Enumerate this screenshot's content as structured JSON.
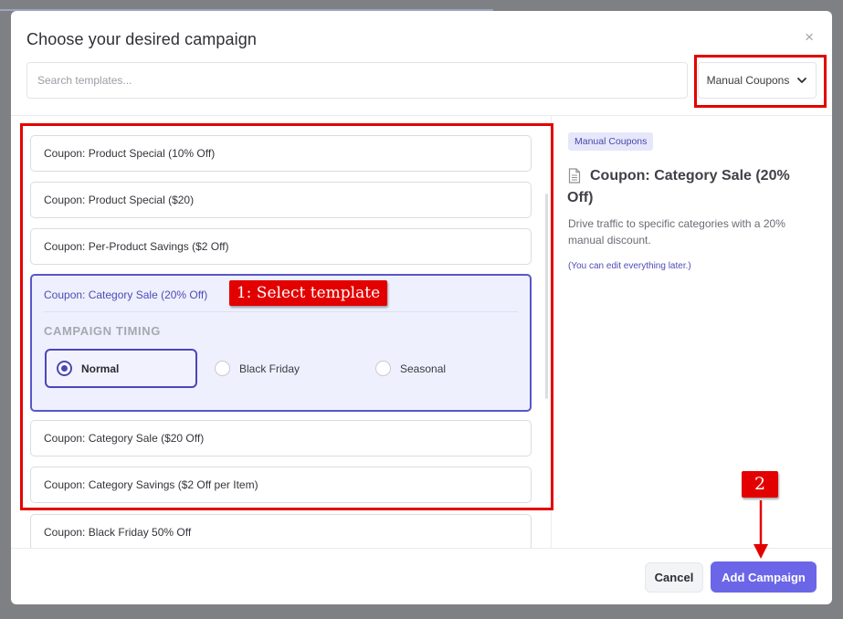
{
  "modal": {
    "title": "Choose your desired campaign",
    "close_glyph": "×"
  },
  "search": {
    "placeholder": "Search templates..."
  },
  "filter": {
    "selected": "Manual Coupons",
    "icon": "chevron-down-icon"
  },
  "templates": {
    "items": [
      {
        "label": "Coupon: Product Special (10% Off)"
      },
      {
        "label": "Coupon: Product Special ($20)"
      },
      {
        "label": "Coupon: Per-Product Savings ($2 Off)"
      },
      {
        "label": "Coupon: Category Sale (20% Off)",
        "selected": true
      },
      {
        "label": "Coupon: Category Sale ($20 Off)"
      },
      {
        "label": "Coupon: Category Savings ($2 Off per Item)"
      },
      {
        "label": "Coupon: Black Friday 50% Off"
      }
    ],
    "timing": {
      "label": "CAMPAIGN TIMING",
      "options": [
        {
          "label": "Normal",
          "selected": true
        },
        {
          "label": "Black Friday",
          "selected": false
        },
        {
          "label": "Seasonal",
          "selected": false
        }
      ]
    }
  },
  "details": {
    "badge": "Manual Coupons",
    "icon": "document-icon",
    "title": "Coupon: Category Sale (20% Off)",
    "description": "Drive traffic to specific categories with a 20% manual discount.",
    "note": "(You can edit everything later.)"
  },
  "footer": {
    "cancel_label": "Cancel",
    "add_label": "Add Campaign"
  },
  "annotations": {
    "step1": "1: Select template",
    "step2": "2",
    "color": "#e30000"
  },
  "colors": {
    "accent": "#6b66e8",
    "selected_border": "#5a56c8",
    "selected_bg": "#eef0fd"
  }
}
